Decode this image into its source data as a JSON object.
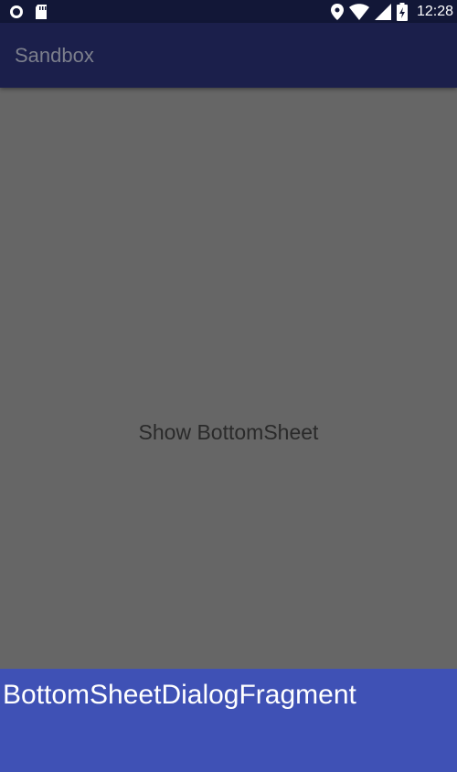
{
  "status_bar": {
    "time": "12:28",
    "icons": [
      "record-icon",
      "sd-card-icon",
      "location-icon",
      "wifi-icon",
      "signal-icon",
      "battery-icon"
    ]
  },
  "app_bar": {
    "title": "Sandbox"
  },
  "main": {
    "button_label": "Show BottomSheet"
  },
  "bottom_sheet": {
    "title": "BottomSheetDialogFragment"
  },
  "colors": {
    "status_bar": "#121737",
    "app_bar": "#1b1f4b",
    "scrim_background": "#666666",
    "bottom_sheet": "#3f51b5",
    "app_title": "#7c7f8c"
  }
}
